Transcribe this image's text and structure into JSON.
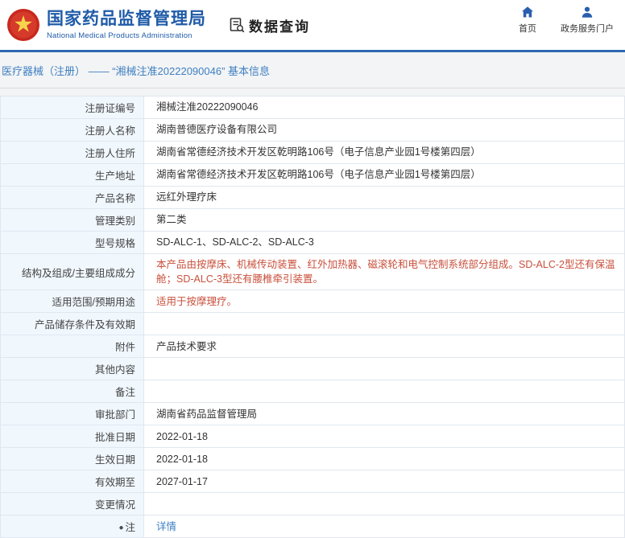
{
  "header": {
    "org_name": "国家药品监督管理局",
    "org_name_en": "National Medical Products Administration",
    "query_title": "数据查询",
    "nav": [
      {
        "label": "首页",
        "icon": "home-icon"
      },
      {
        "label": "政务服务门户",
        "icon": "person-icon"
      }
    ]
  },
  "icons": {
    "note_bullet": "●"
  },
  "colors": {
    "brand_blue": "#1f5ba8",
    "divider_blue": "#2d69b3",
    "link_blue": "#3e7fc1",
    "label_cell_bg": "#f0f7fd",
    "warning_red": "#c9503c"
  },
  "page": {
    "breadcrumb_title": "医疗器械（注册） ——  “湘械注准20222090046” 基本信息"
  },
  "table": {
    "rows": [
      {
        "label": "注册证编号",
        "value": "湘械注准20222090046"
      },
      {
        "label": "注册人名称",
        "value": "湖南普德医疗设备有限公司"
      },
      {
        "label": "注册人住所",
        "value": "湖南省常德经济技术开发区乾明路106号（电子信息产业园1号楼第四层）"
      },
      {
        "label": "生产地址",
        "value": "湖南省常德经济技术开发区乾明路106号（电子信息产业园1号楼第四层）"
      },
      {
        "label": "产品名称",
        "value": "远红外理疗床"
      },
      {
        "label": "管理类别",
        "value": "第二类"
      },
      {
        "label": "型号规格",
        "value": "SD-ALC-1、SD-ALC-2、SD-ALC-3"
      },
      {
        "label": "结构及组成/主要组成成分",
        "value": "本产品由按摩床、机械传动装置、红外加热器、磁滚轮和电气控制系统部分组成。SD-ALC-2型还有保温舱；SD-ALC-3型还有腰椎牵引装置。"
      },
      {
        "label": "适用范围/预期用途",
        "value": "适用于按摩理疗。"
      },
      {
        "label": "产品储存条件及有效期",
        "value": ""
      },
      {
        "label": "附件",
        "value": "产品技术要求"
      },
      {
        "label": "其他内容",
        "value": ""
      },
      {
        "label": "备注",
        "value": ""
      },
      {
        "label": "审批部门",
        "value": "湖南省药品监督管理局"
      },
      {
        "label": "批准日期",
        "value": "2022-01-18"
      },
      {
        "label": "生效日期",
        "value": "2022-01-18"
      },
      {
        "label": "有效期至",
        "value": "2027-01-17"
      },
      {
        "label": "变更情况",
        "value": ""
      },
      {
        "label": "注",
        "value": "详情"
      }
    ]
  }
}
